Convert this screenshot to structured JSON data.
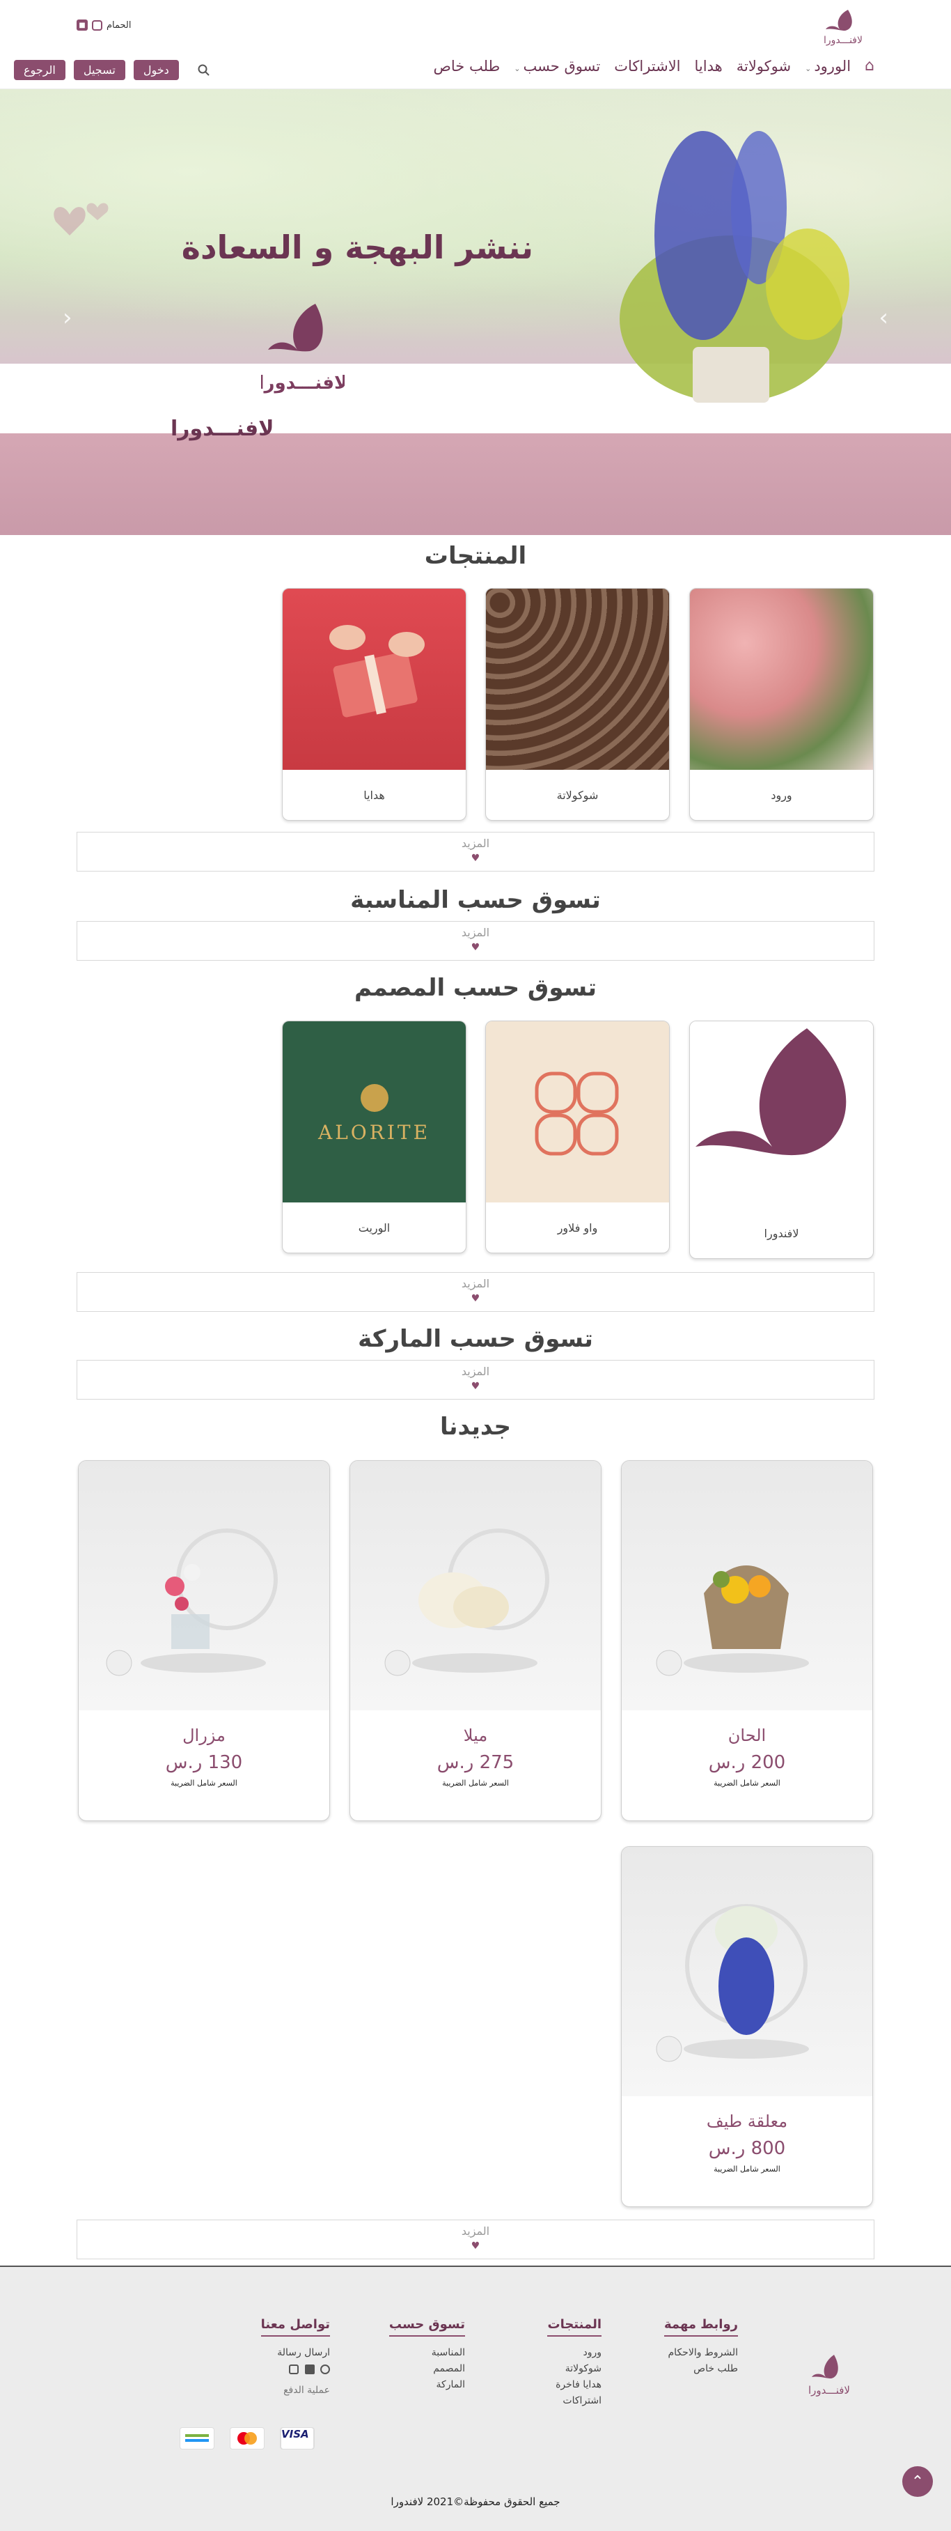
{
  "header": {
    "logo_text": "لافنـــدورا",
    "user_link": "الحمام",
    "nav": [
      {
        "label": "الورود",
        "has_dropdown": true
      },
      {
        "label": "شوكولاتة",
        "has_dropdown": false
      },
      {
        "label": "هدايا",
        "has_dropdown": false
      },
      {
        "label": "الاشتراكات",
        "has_dropdown": false
      },
      {
        "label": "تسوق حسب",
        "has_dropdown": true
      },
      {
        "label": "طلب خاص",
        "has_dropdown": false
      }
    ],
    "buttons": {
      "login": "دخول",
      "register": "تسجيل",
      "back": "الرجوع"
    }
  },
  "hero": {
    "title": "ننشر البهجة و السعادة",
    "logo_text": "لافنـــدورا",
    "sub_text": "لافنـــدورا",
    "prev_icon": "chevron-left-icon",
    "next_icon": "chevron-right-icon"
  },
  "sections": {
    "products_title": "المنتجات",
    "occasion_title": "تسوق حسب المناسبة",
    "designer_title": "تسوق حسب المصمم",
    "brand_title": "تسوق حسب الماركة",
    "new_title": "جديدنا",
    "more_label": "المزيد"
  },
  "categories": [
    {
      "label": "ورود",
      "image": "roses-photo"
    },
    {
      "label": "شوكولاتة",
      "image": "chocolate-box-photo"
    },
    {
      "label": "هدايا",
      "image": "gift-box-photo"
    }
  ],
  "designers": [
    {
      "label": "لافندورا",
      "image": "lavandora-logo"
    },
    {
      "label": "واو فلاور",
      "image": "wow-flower-logo"
    },
    {
      "label": "الوريت",
      "image": "alorite-logo",
      "logo_text": "ALORITE"
    }
  ],
  "new_products": [
    {
      "name": "الحان",
      "price": "200 ر.س",
      "tax": "السعر شامل الضريبة"
    },
    {
      "name": "ميلا",
      "price": "275 ر.س",
      "tax": "السعر شامل الضريبة"
    },
    {
      "name": "مزرال",
      "price": "130 ر.س",
      "tax": "السعر شامل الضريبة"
    },
    {
      "name": "معلقة طيف",
      "price": "800 ر.س",
      "tax": "السعر شامل الضريبة"
    }
  ],
  "footer": {
    "logo_text": "لافنـــدورا",
    "columns": [
      {
        "title": "روابط مهمة",
        "items": [
          "الشروط والاحكام",
          "طلب خاص"
        ]
      },
      {
        "title": "المنتجات",
        "items": [
          "ورود",
          "شوكولاتة",
          "هدايا فاخرة",
          "اشتراكات"
        ]
      },
      {
        "title": "تسوق حسب",
        "items": [
          "المناسبة",
          "المصمم",
          "الماركة"
        ]
      },
      {
        "title": "تواصل معنا",
        "items": [
          "ارسال رسالة"
        ]
      }
    ],
    "payment_label": "عملية الدفع",
    "payment_methods": [
      "VISA",
      "mastercard",
      "mada"
    ],
    "copyright": "جميع الحقوق محفوظة©2021 لافندورا"
  },
  "colors": {
    "brand": "#8b4d6e",
    "brand_dark": "#6b3552"
  }
}
